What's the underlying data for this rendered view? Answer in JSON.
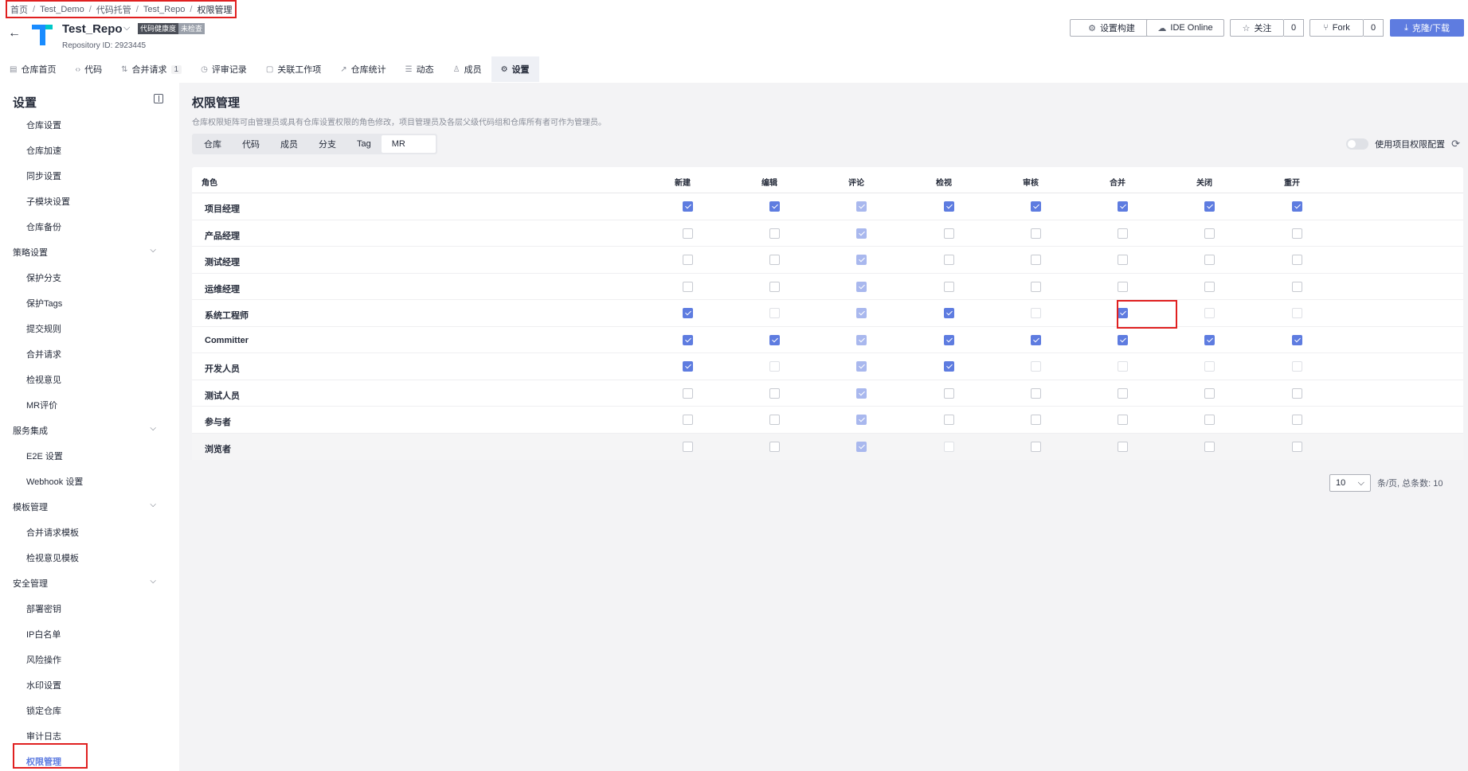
{
  "breadcrumb": [
    "首页",
    "Test_Demo",
    "代码托管",
    "Test_Repo",
    "权限管理"
  ],
  "repo": {
    "name": "Test_Repo",
    "health_label": "代码健康度",
    "health_value": "未检查",
    "repo_id": "Repository ID: 2923445"
  },
  "header_buttons": {
    "build": "设置构建",
    "ide": "IDE Online",
    "follow": "关注",
    "follow_count": "0",
    "fork": "Fork",
    "fork_count": "0",
    "clone": "克隆/下载"
  },
  "tabs": [
    {
      "label": "仓库首页",
      "icon": "▤"
    },
    {
      "label": "代码",
      "icon": "‹›"
    },
    {
      "label": "合并请求",
      "icon": "⇅",
      "count": "1"
    },
    {
      "label": "评审记录",
      "icon": "◷"
    },
    {
      "label": "关联工作项",
      "icon": "▢"
    },
    {
      "label": "仓库统计",
      "icon": "↗"
    },
    {
      "label": "动态",
      "icon": "☰"
    },
    {
      "label": "成员",
      "icon": "♙"
    },
    {
      "label": "设置",
      "icon": "⚙"
    }
  ],
  "sidebar": {
    "title": "设置",
    "items": [
      {
        "type": "item",
        "label": "仓库设置"
      },
      {
        "type": "item",
        "label": "仓库加速"
      },
      {
        "type": "item",
        "label": "同步设置"
      },
      {
        "type": "item",
        "label": "子模块设置"
      },
      {
        "type": "item",
        "label": "仓库备份"
      },
      {
        "type": "group",
        "label": "策略设置"
      },
      {
        "type": "item",
        "label": "保护分支"
      },
      {
        "type": "item",
        "label": "保护Tags"
      },
      {
        "type": "item",
        "label": "提交规则"
      },
      {
        "type": "item",
        "label": "合并请求"
      },
      {
        "type": "item",
        "label": "检视意见"
      },
      {
        "type": "item",
        "label": "MR评价"
      },
      {
        "type": "group",
        "label": "服务集成"
      },
      {
        "type": "item",
        "label": "E2E 设置"
      },
      {
        "type": "item",
        "label": "Webhook 设置"
      },
      {
        "type": "group",
        "label": "模板管理"
      },
      {
        "type": "item",
        "label": "合并请求模板"
      },
      {
        "type": "item",
        "label": "检视意见模板"
      },
      {
        "type": "group",
        "label": "安全管理"
      },
      {
        "type": "item",
        "label": "部署密钥"
      },
      {
        "type": "item",
        "label": "IP白名单"
      },
      {
        "type": "item",
        "label": "风险操作"
      },
      {
        "type": "item",
        "label": "水印设置"
      },
      {
        "type": "item",
        "label": "锁定仓库"
      },
      {
        "type": "item",
        "label": "审计日志"
      },
      {
        "type": "item",
        "label": "权限管理",
        "active": true
      }
    ]
  },
  "main": {
    "title": "权限管理",
    "description": "仓库权限矩阵可由管理员或具有仓库设置权限的角色修改，项目管理员及各层父级代码组和仓库所有者可作为管理员。",
    "perm_tabs": [
      "仓库",
      "代码",
      "成员",
      "分支",
      "Tag",
      "MR"
    ],
    "active_perm_tab": "MR",
    "toggle_label": "使用项目权限配置"
  },
  "matrix": {
    "role_header": "角色",
    "columns": [
      "新建",
      "编辑",
      "评论",
      "检视",
      "审核",
      "合并",
      "关闭",
      "重开"
    ],
    "rows": [
      {
        "role": "项目经理",
        "checks": [
          1,
          1,
          1,
          1,
          1,
          1,
          1,
          1
        ],
        "disabled": [
          0,
          0,
          1,
          0,
          0,
          0,
          0,
          0
        ]
      },
      {
        "role": "产品经理",
        "checks": [
          0,
          0,
          1,
          0,
          0,
          0,
          0,
          0
        ],
        "disabled": [
          0,
          0,
          1,
          0,
          0,
          0,
          0,
          0
        ]
      },
      {
        "role": "测试经理",
        "checks": [
          0,
          0,
          1,
          0,
          0,
          0,
          0,
          0
        ],
        "disabled": [
          0,
          0,
          1,
          0,
          0,
          0,
          0,
          0
        ]
      },
      {
        "role": "运维经理",
        "checks": [
          0,
          0,
          1,
          0,
          0,
          0,
          0,
          0
        ],
        "disabled": [
          0,
          0,
          1,
          0,
          0,
          0,
          0,
          0
        ]
      },
      {
        "role": "系统工程师",
        "checks": [
          1,
          0,
          1,
          1,
          0,
          1,
          0,
          0
        ],
        "disabled": [
          0,
          1,
          1,
          0,
          1,
          0,
          1,
          1
        ]
      },
      {
        "role": "Committer",
        "checks": [
          1,
          1,
          1,
          1,
          1,
          1,
          1,
          1
        ],
        "disabled": [
          0,
          0,
          1,
          0,
          0,
          0,
          0,
          0
        ]
      },
      {
        "role": "开发人员",
        "checks": [
          1,
          0,
          1,
          1,
          0,
          0,
          0,
          0
        ],
        "disabled": [
          0,
          1,
          1,
          0,
          1,
          1,
          1,
          1
        ]
      },
      {
        "role": "测试人员",
        "checks": [
          0,
          0,
          1,
          0,
          0,
          0,
          0,
          0
        ],
        "disabled": [
          0,
          0,
          1,
          0,
          0,
          0,
          0,
          0
        ]
      },
      {
        "role": "参与者",
        "checks": [
          0,
          0,
          1,
          0,
          0,
          0,
          0,
          0
        ],
        "disabled": [
          0,
          0,
          1,
          0,
          0,
          0,
          0,
          0
        ]
      },
      {
        "role": "浏览者",
        "checks": [
          0,
          0,
          1,
          0,
          0,
          0,
          0,
          0
        ],
        "disabled": [
          0,
          0,
          1,
          1,
          0,
          0,
          0,
          0
        ]
      }
    ]
  },
  "pagination": {
    "page_size": "10",
    "summary": "条/页, 总条数: 10"
  },
  "colors": {
    "primary": "#5e7ce0",
    "highlight": "#e02020"
  }
}
